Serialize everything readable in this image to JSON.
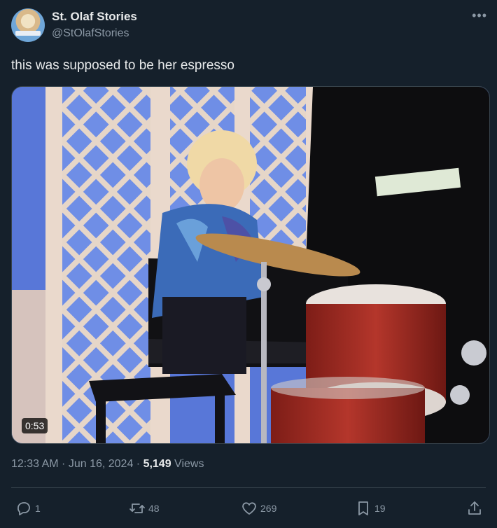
{
  "author": {
    "display_name": "St. Olaf Stories",
    "handle": "@StOlafStories"
  },
  "tweet": {
    "text": "this was supposed to be her espresso",
    "timestamp": "12:33 AM · Jun 16, 2024 · ",
    "views_count": "5,149",
    "views_label": " Views"
  },
  "media": {
    "duration": "0:53"
  },
  "actions": {
    "replies": "1",
    "retweets": "48",
    "likes": "269",
    "bookmarks": "19"
  },
  "icons": {
    "more": "more-options-icon",
    "reply": "reply-icon",
    "retweet": "retweet-icon",
    "like": "heart-icon",
    "bookmark": "bookmark-icon",
    "share": "share-icon"
  },
  "colors": {
    "background": "#15202b",
    "primary_text": "#e7e9ea",
    "secondary_text": "#8b98a5",
    "border": "#38444d"
  }
}
